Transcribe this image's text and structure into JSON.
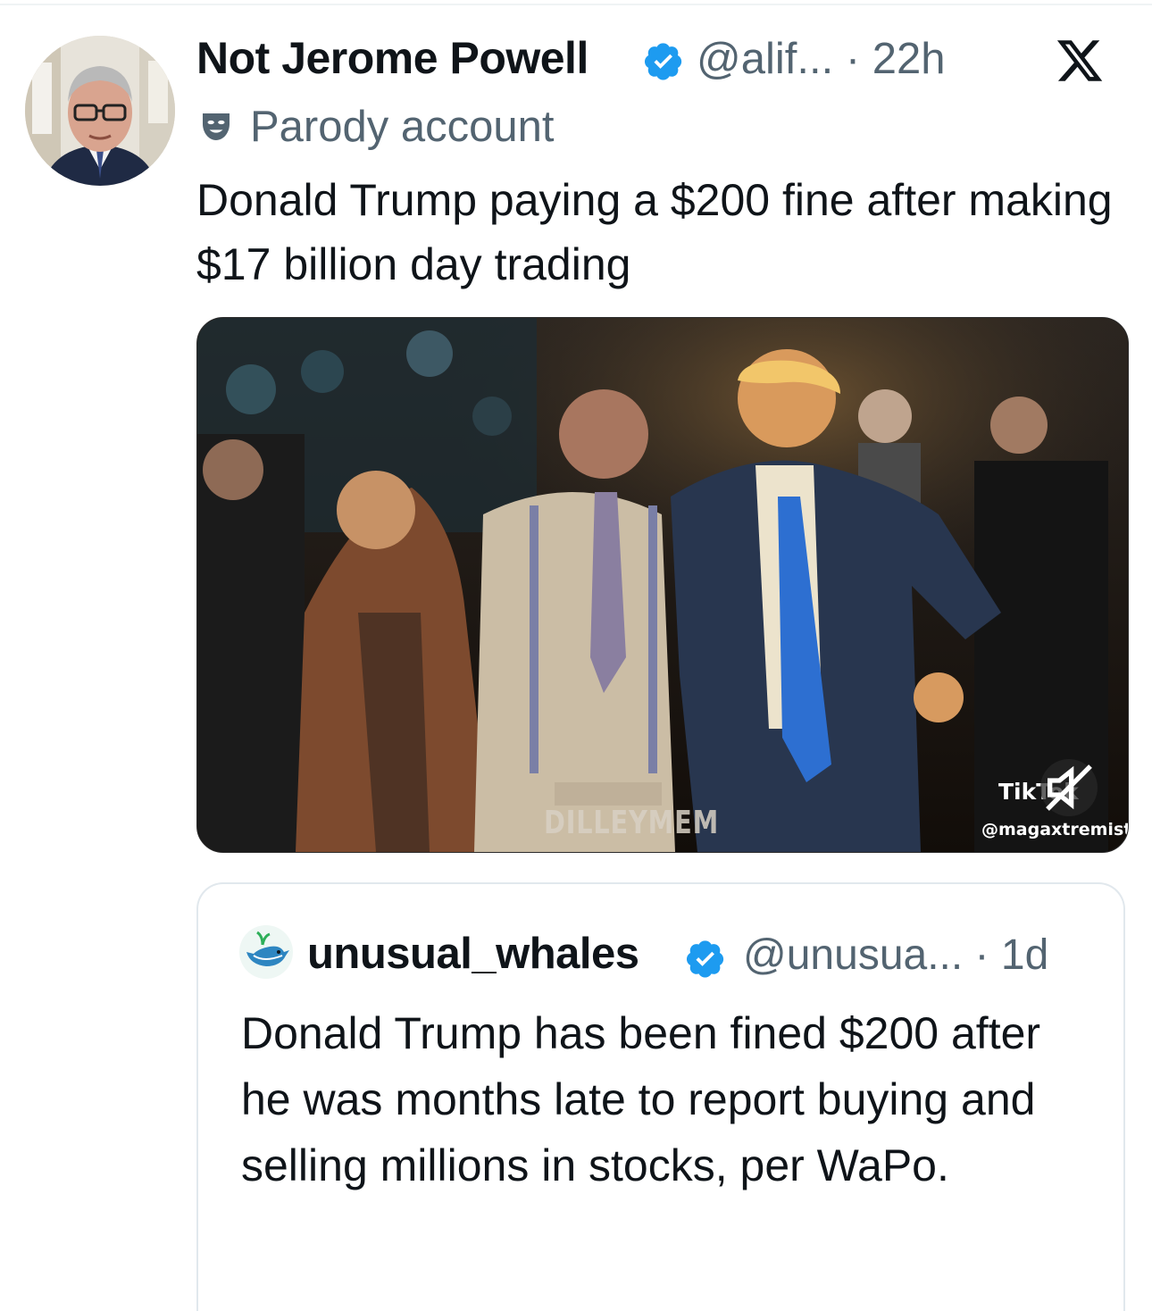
{
  "tweet": {
    "display_name": "Not Jerome Powell",
    "handle_time": "@alif... · 22h",
    "parody_label": "Parody account",
    "text": "Donald Trump paying a $200 fine after making $17 billion day trading",
    "icons": {
      "verified": "verified-badge-icon",
      "platform": "x-logo-icon",
      "parody": "theater-mask-icon"
    },
    "accent_color": "#1d9bf0"
  },
  "media": {
    "watermark_brand": "TikTok",
    "watermark_handle": "@magaxtremist",
    "overlay_text": "DILLEYMEM",
    "mute_icon": "muted-speaker-icon"
  },
  "quoted_tweet": {
    "display_name": "unusual_whales",
    "handle_time": "@unusua... · 1d",
    "text": "Donald Trump has been fined $200 after he was months late to report buying and selling millions in stocks, per WaPo.",
    "avatar_icon": "whale-icon"
  }
}
